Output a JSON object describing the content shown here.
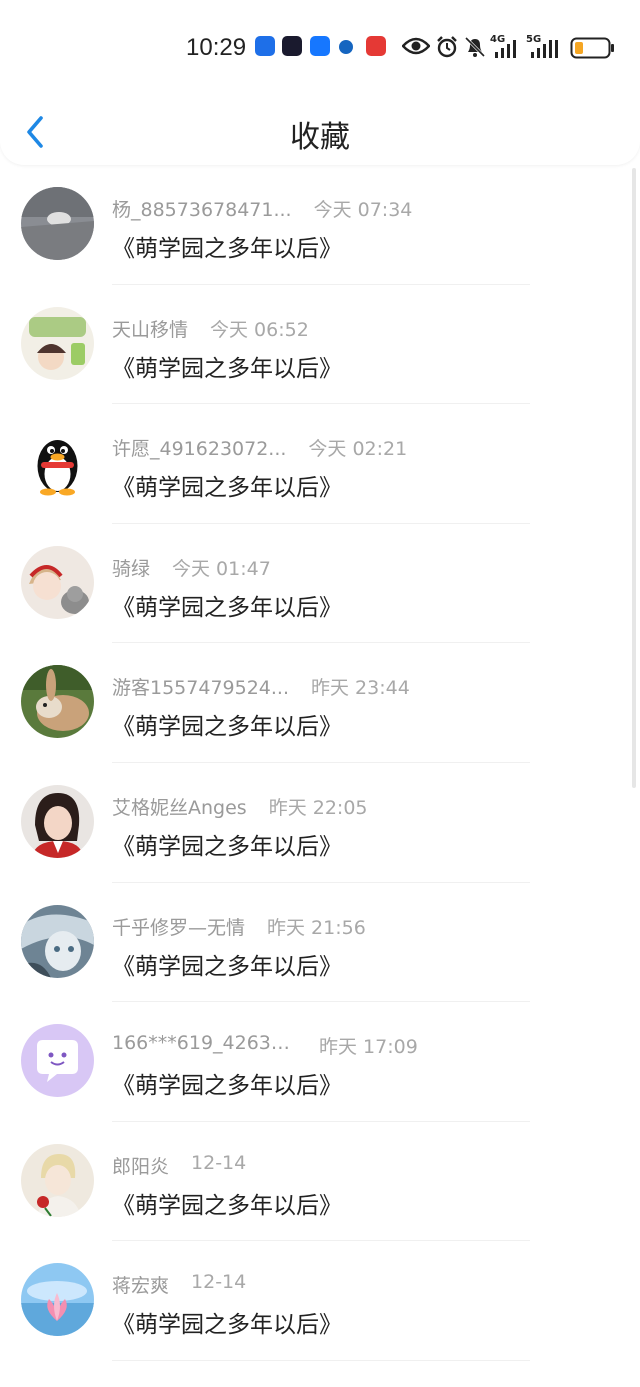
{
  "status_bar": {
    "time": "10:29",
    "network_4g": "4G",
    "network_5g": "5G"
  },
  "header": {
    "title": "收藏"
  },
  "items": [
    {
      "name": "杨_88573678471...",
      "time": "今天 07:34",
      "book": "《萌学园之多年以后》"
    },
    {
      "name": "天山移情",
      "time": "今天 06:52",
      "book": "《萌学园之多年以后》"
    },
    {
      "name": "许愿_491623072...",
      "time": "今天 02:21",
      "book": "《萌学园之多年以后》"
    },
    {
      "name": "骑绿",
      "time": "今天 01:47",
      "book": "《萌学园之多年以后》"
    },
    {
      "name": "游客1557479524...",
      "time": "昨天 23:44",
      "book": "《萌学园之多年以后》"
    },
    {
      "name": "艾格妮丝Anges",
      "time": "昨天 22:05",
      "book": "《萌学园之多年以后》"
    },
    {
      "name": "千乎修罗—无情",
      "time": "昨天 21:56",
      "book": "《萌学园之多年以后》"
    },
    {
      "name": "166***619_42633...",
      "time": "昨天 17:09",
      "book": "《萌学园之多年以后》"
    },
    {
      "name": "郎阳炎",
      "time": "12-14",
      "book": "《萌学园之多年以后》"
    },
    {
      "name": "蒋宏爽",
      "time": "12-14",
      "book": "《萌学园之多年以后》"
    }
  ],
  "colors": {
    "accent": "#1e88e5",
    "text_primary": "#222222",
    "text_secondary": "#9a9a9a"
  },
  "icons": [
    "back-arrow-icon",
    "eye-icon",
    "alarm-icon",
    "mute-bell-icon",
    "signal-icon",
    "battery-icon"
  ]
}
